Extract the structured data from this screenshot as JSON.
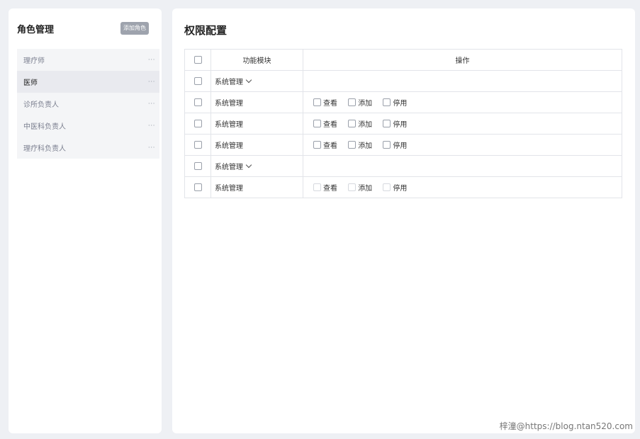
{
  "left": {
    "title": "角色管理",
    "add_label": "添加角色",
    "roles": [
      {
        "label": "理疗师",
        "more": "···"
      },
      {
        "label": "医师",
        "more": "···"
      },
      {
        "label": "诊所负责人",
        "more": "···"
      },
      {
        "label": "中医科负责人",
        "more": "···"
      },
      {
        "label": "理疗科负责人",
        "more": "···"
      }
    ],
    "active_role": "医师"
  },
  "right": {
    "title": "权限配置",
    "columns": {
      "module": "功能模块",
      "operation": "操作"
    },
    "rows": [
      {
        "module": "系统管理",
        "expandable": true,
        "ops": []
      },
      {
        "module": "系统管理",
        "expandable": false,
        "ops": [
          "查看",
          "添加",
          "停用"
        ]
      },
      {
        "module": "系统管理",
        "expandable": false,
        "ops": [
          "查看",
          "添加",
          "停用"
        ]
      },
      {
        "module": "系统管理",
        "expandable": false,
        "ops": [
          "查看",
          "添加",
          "停用"
        ]
      },
      {
        "module": "系统管理",
        "expandable": true,
        "ops": []
      },
      {
        "module": "系统管理",
        "expandable": false,
        "ops": [
          "查看",
          "添加",
          "停用"
        ]
      }
    ]
  },
  "watermark": "梓潼@https://blog.ntan520.com"
}
